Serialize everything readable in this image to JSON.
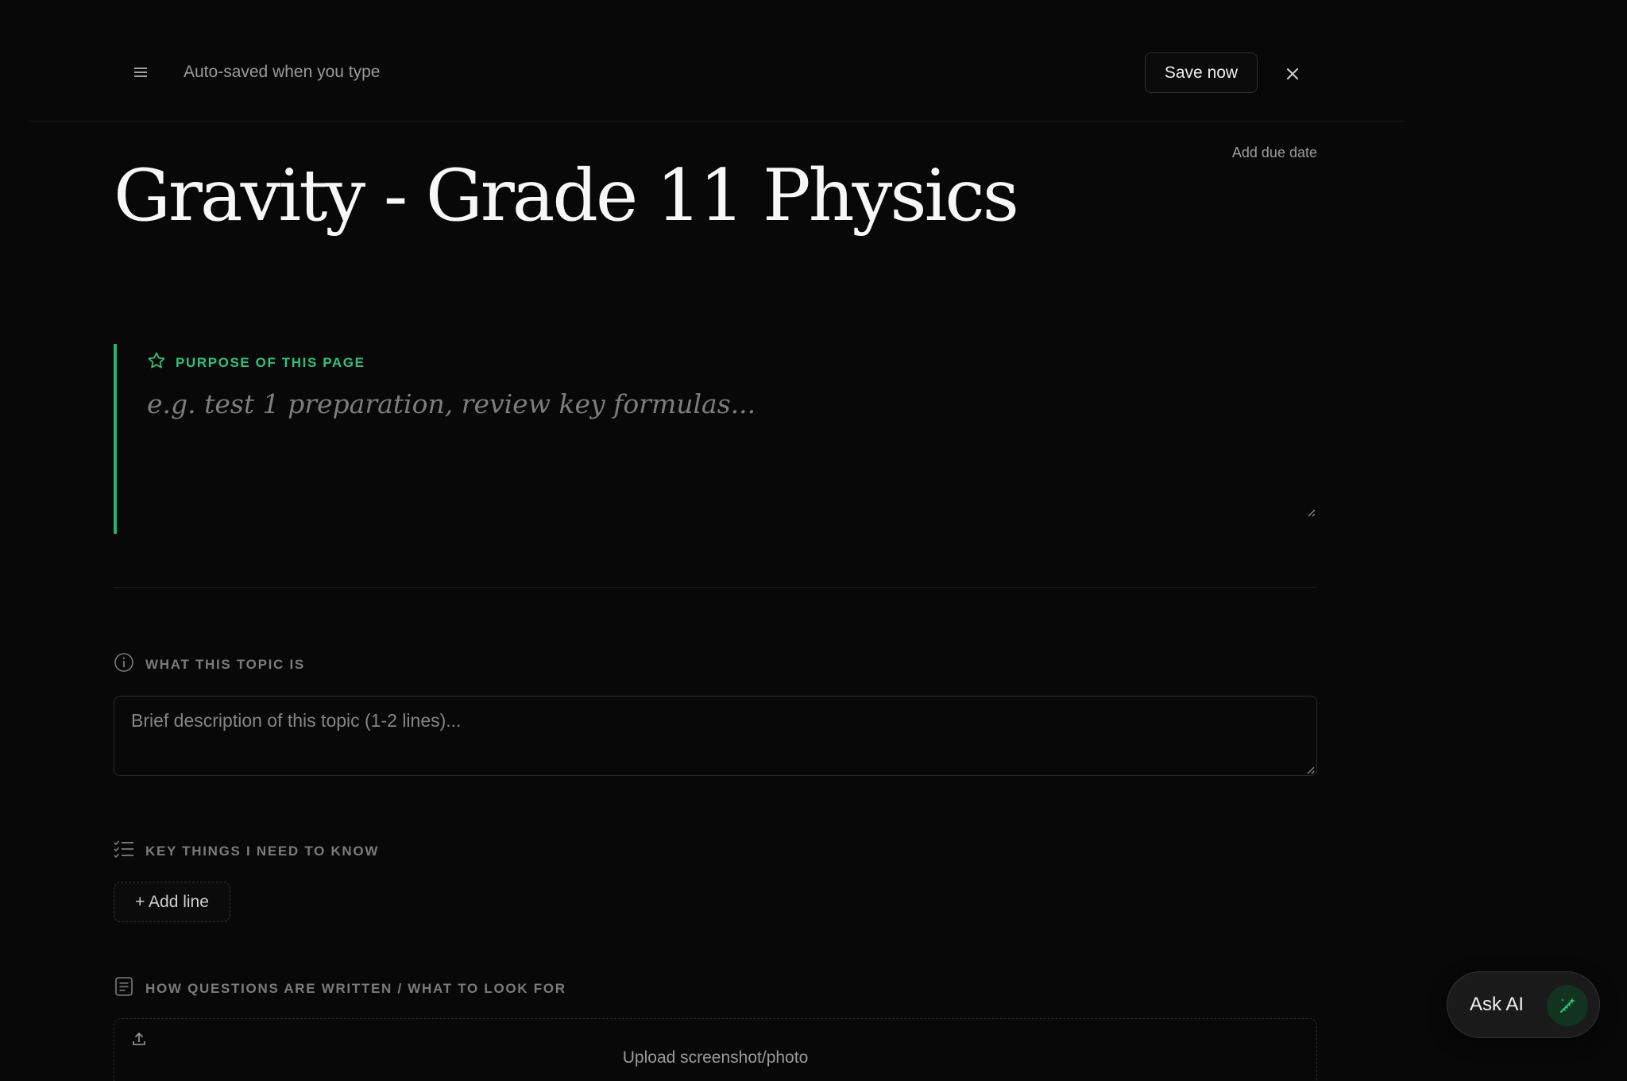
{
  "header": {
    "menu_icon": "hamburger-menu-icon",
    "autosave_text": "Auto-saved when you type",
    "save_label": "Save now",
    "close_icon": "close-icon"
  },
  "page": {
    "due_date_label": "Add due date",
    "title": "Gravity - Grade 11 Physics"
  },
  "purpose": {
    "icon": "star-icon",
    "label": "PURPOSE OF THIS PAGE",
    "placeholder": "e.g. test 1 preparation, review key formulas...",
    "value": ""
  },
  "sections": {
    "topic": {
      "icon": "info-icon",
      "label": "WHAT THIS TOPIC IS",
      "placeholder": "Brief description of this topic (1-2 lines)...",
      "value": ""
    },
    "key_things": {
      "icon": "checklist-icon",
      "label": "KEY THINGS I NEED TO KNOW",
      "add_label": "+ Add line"
    },
    "questions": {
      "icon": "document-icon",
      "label": "HOW QUESTIONS ARE WRITTEN / WHAT TO LOOK FOR",
      "upload_icon": "upload-icon",
      "upload_label": "Upload screenshot/photo"
    }
  },
  "ask_ai": {
    "label": "Ask AI",
    "icon": "sparkle-pen-icon"
  },
  "colors": {
    "background": "#080808",
    "accent": "#2bc37d",
    "text_primary": "#f7f7f7",
    "text_muted": "#9a9a9a"
  }
}
